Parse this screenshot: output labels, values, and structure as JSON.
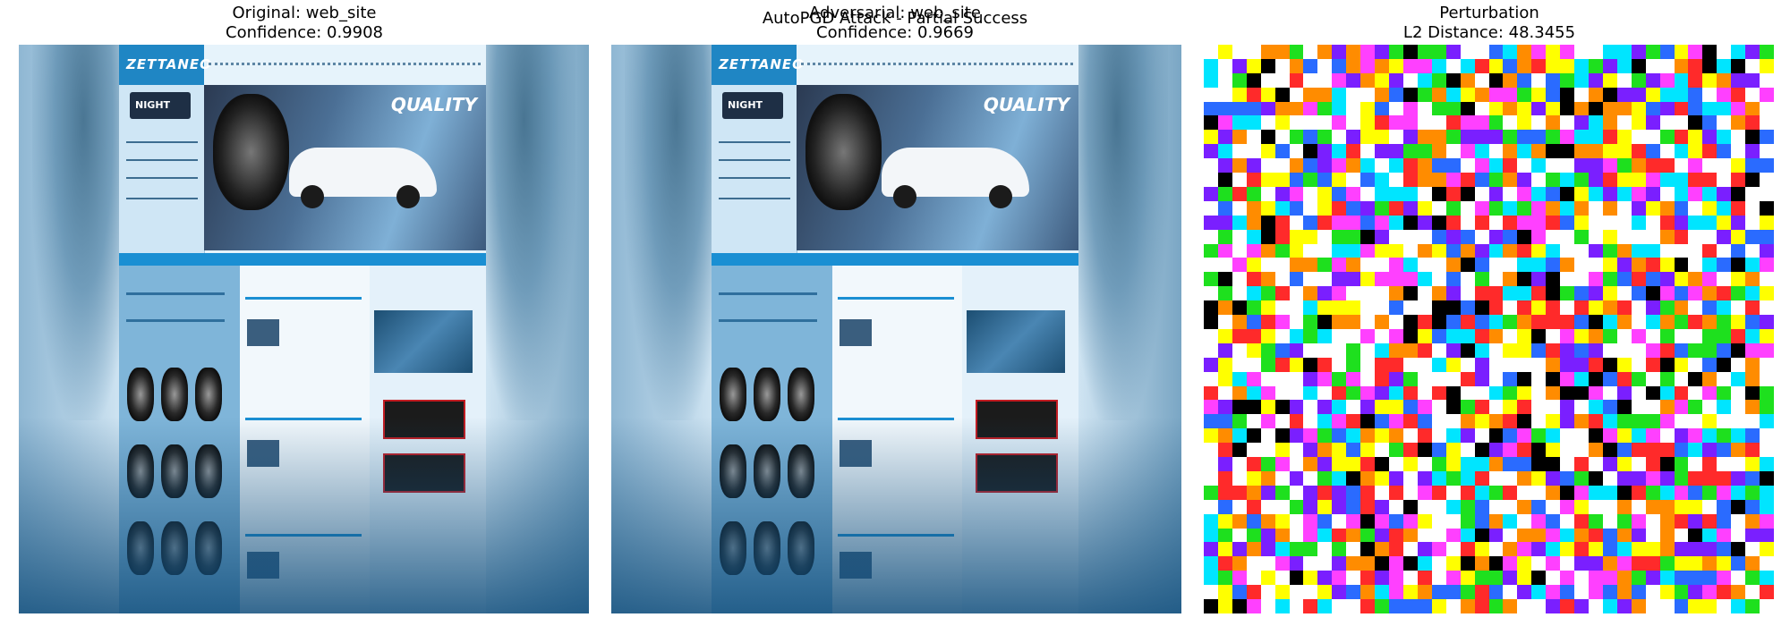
{
  "figure": {
    "suptitle": "AutoPGD Attack - Partial Success"
  },
  "panels": [
    {
      "title_line1": "Original: web_site",
      "title_line2": "Confidence: 0.9908"
    },
    {
      "title_line1": "Adversarial: web_site",
      "title_line2": "Confidence: 0.9669"
    },
    {
      "title_line1": "Perturbation",
      "title_line2": "L2 Distance: 48.3455"
    }
  ],
  "thumbnail": {
    "logo_text": "ZETTANEO",
    "badge_text": "NIGHT",
    "banner_text": "QUALITY"
  },
  "noise_palette": [
    "#ff2a2a",
    "#2a6bff",
    "#1ee01e",
    "#ffff00",
    "#ff40ff",
    "#00e5ff",
    "#000000",
    "#ffffff",
    "#ff8c00",
    "#7a1fff",
    "#ffffff",
    "#ffffff"
  ]
}
